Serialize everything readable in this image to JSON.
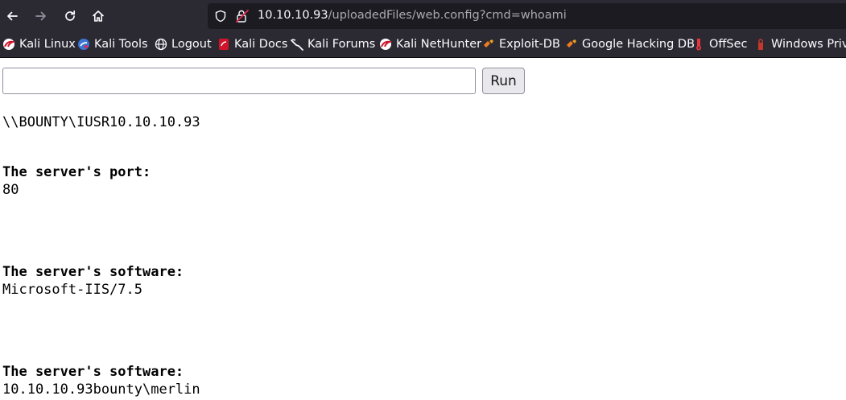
{
  "browser": {
    "url_host": "10.10.10.93",
    "url_path": "/uploadedFiles/web.config?cmd=whoami",
    "icons": [
      "back-arrow-icon",
      "forward-arrow-icon",
      "reload-icon",
      "home-icon",
      "shield-icon",
      "insecure-lock-icon"
    ],
    "colors": {
      "chrome_bg": "#2b2a33",
      "urlbar_bg": "#1c1b22",
      "text": "#fbfbfe",
      "path_text": "#a9a9ae"
    }
  },
  "bookmarks": [
    {
      "label": "Kali Linux",
      "icon": "kali-dragon-icon"
    },
    {
      "label": "Kali Tools",
      "icon": "kali-tools-icon"
    },
    {
      "label": "Logout",
      "icon": "globe-icon"
    },
    {
      "label": "Kali Docs",
      "icon": "kali-docs-icon"
    },
    {
      "label": "Kali Forums",
      "icon": "kali-forums-icon"
    },
    {
      "label": "Kali NetHunter",
      "icon": "kali-nethunter-icon"
    },
    {
      "label": "Exploit-DB",
      "icon": "exploit-db-icon"
    },
    {
      "label": "Google Hacking DB",
      "icon": "ghdb-icon"
    },
    {
      "label": "OffSec",
      "icon": "offsec-icon"
    },
    {
      "label": "Windows Privi",
      "icon": "windows-privesc-icon"
    }
  ],
  "form": {
    "input_value": "",
    "run_label": "Run"
  },
  "output": {
    "whoami": "\\\\BOUNTY\\IUSR10.10.10.93",
    "port_heading": "The server's port:",
    "port_value": "80",
    "software_heading": "The server's software:",
    "software_value": "Microsoft-IIS/7.5",
    "software_heading_2": "The server's software:",
    "software_value_2": "10.10.10.93bounty\\merlin"
  }
}
